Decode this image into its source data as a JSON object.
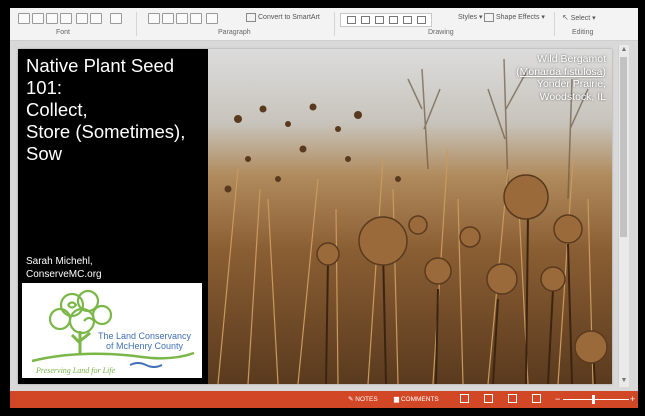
{
  "ribbon": {
    "groups": {
      "font": "Font",
      "paragraph": "Paragraph",
      "drawing": "Drawing",
      "editing": "Editing"
    },
    "buttons": {
      "convert_smartart": "Convert to SmartArt",
      "styles": "Styles",
      "shape_effects": "Shape Effects",
      "select": "Select"
    }
  },
  "slide": {
    "title": "Native Plant Seed\n101:\nCollect,\nStore (Sometimes),\nSow",
    "author_name": "Sarah Michehl,",
    "author_site": "ConserveMC.org",
    "logo": {
      "line1": "The Land Conservancy",
      "line2": "of McHenry County",
      "tagline": "Preserving Land for Life"
    },
    "caption": {
      "line1": "Wild Bergamot",
      "line2": "(Monarda fistulosa)",
      "line3": "Yonder Prairie,",
      "line4": "Woodstock, IL"
    }
  },
  "status_bar": {
    "notes": "NOTES",
    "comments": "COMMENTS"
  },
  "colors": {
    "status_bar": "#d24726",
    "logo_green": "#7ab648",
    "logo_blue": "#3f6fb6"
  }
}
